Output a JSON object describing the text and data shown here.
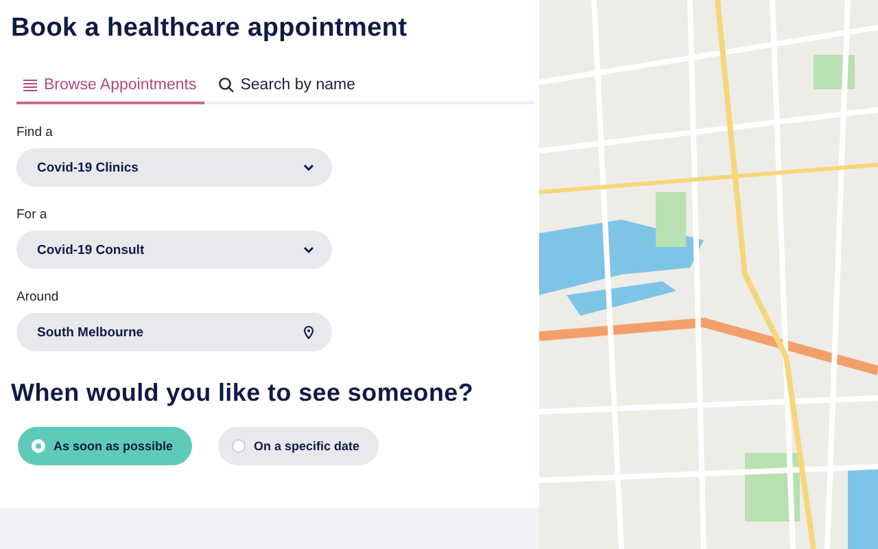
{
  "title": "Book a healthcare appointment",
  "tabs": [
    {
      "label": "Browse Appointments",
      "kind": "browse",
      "selected": true
    },
    {
      "label": "Search by name",
      "kind": "search",
      "selected": false
    }
  ],
  "fields": [
    {
      "label": "Find a",
      "value": "Covid-19 Clinics",
      "kind": "dropdown"
    },
    {
      "label": "For a",
      "value": "Covid-19 Consult",
      "kind": "dropdown"
    },
    {
      "label": "Around",
      "value": "South Melbourne",
      "kind": "location"
    }
  ],
  "when": {
    "heading": "When would you like to see someone?",
    "options": [
      {
        "label": "As soon as possible",
        "selected": true
      },
      {
        "label": "On a specific date",
        "selected": false
      }
    ]
  }
}
